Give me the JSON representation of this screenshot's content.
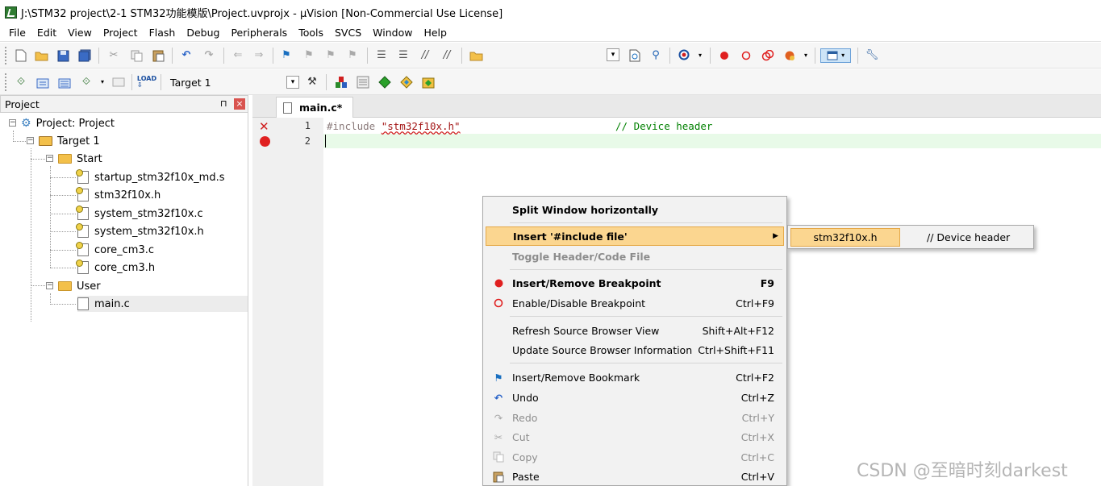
{
  "titlebar": {
    "title": "J:\\STM32 project\\2-1 STM32功能模版\\Project.uvprojx - µVision  [Non-Commercial Use License]"
  },
  "menubar": {
    "items": [
      "File",
      "Edit",
      "View",
      "Project",
      "Flash",
      "Debug",
      "Peripherals",
      "Tools",
      "SVCS",
      "Window",
      "Help"
    ]
  },
  "toolbar2": {
    "target_select": "Target 1"
  },
  "project_panel": {
    "title": "Project",
    "pin": "⊓",
    "close": "×",
    "tree": {
      "root": "Project: Project",
      "target": "Target 1",
      "group_start": "Start",
      "start_files": [
        "startup_stm32f10x_md.s",
        "stm32f10x.h",
        "system_stm32f10x.c",
        "system_stm32f10x.h",
        "core_cm3.c",
        "core_cm3.h"
      ],
      "group_user": "User",
      "user_files": [
        "main.c"
      ]
    }
  },
  "editor": {
    "tab_label": "main.c*",
    "line_numbers": [
      "1",
      "2"
    ],
    "line1_directive": "#include ",
    "line1_file": "\"stm32f10x.h\"",
    "line1_comment": "// Device header"
  },
  "context_menu": {
    "items": [
      {
        "label": "Split Window horizontally",
        "shortcut": ""
      },
      {
        "label": "Insert '#include file'",
        "shortcut": ""
      },
      {
        "label": "Toggle Header/Code File",
        "shortcut": ""
      },
      {
        "label": "Insert/Remove Breakpoint",
        "shortcut": "F9"
      },
      {
        "label": "Enable/Disable Breakpoint",
        "shortcut": "Ctrl+F9"
      },
      {
        "label": "Refresh Source Browser View",
        "shortcut": "Shift+Alt+F12"
      },
      {
        "label": "Update Source Browser Information",
        "shortcut": "Ctrl+Shift+F11"
      },
      {
        "label": "Insert/Remove Bookmark",
        "shortcut": "Ctrl+F2"
      },
      {
        "label": "Undo",
        "shortcut": "Ctrl+Z"
      },
      {
        "label": "Redo",
        "shortcut": "Ctrl+Y"
      },
      {
        "label": "Cut",
        "shortcut": "Ctrl+X"
      },
      {
        "label": "Copy",
        "shortcut": "Ctrl+C"
      },
      {
        "label": "Paste",
        "shortcut": "Ctrl+V"
      }
    ]
  },
  "submenu": {
    "file": "stm32f10x.h",
    "description": "// Device header"
  },
  "watermark": "CSDN @至暗时刻darkest",
  "colors": {
    "highlight": "#fbd690",
    "current_line": "#e8fae8",
    "comment": "#008000",
    "string": "#a31515",
    "breakpoint": "#e02020"
  }
}
